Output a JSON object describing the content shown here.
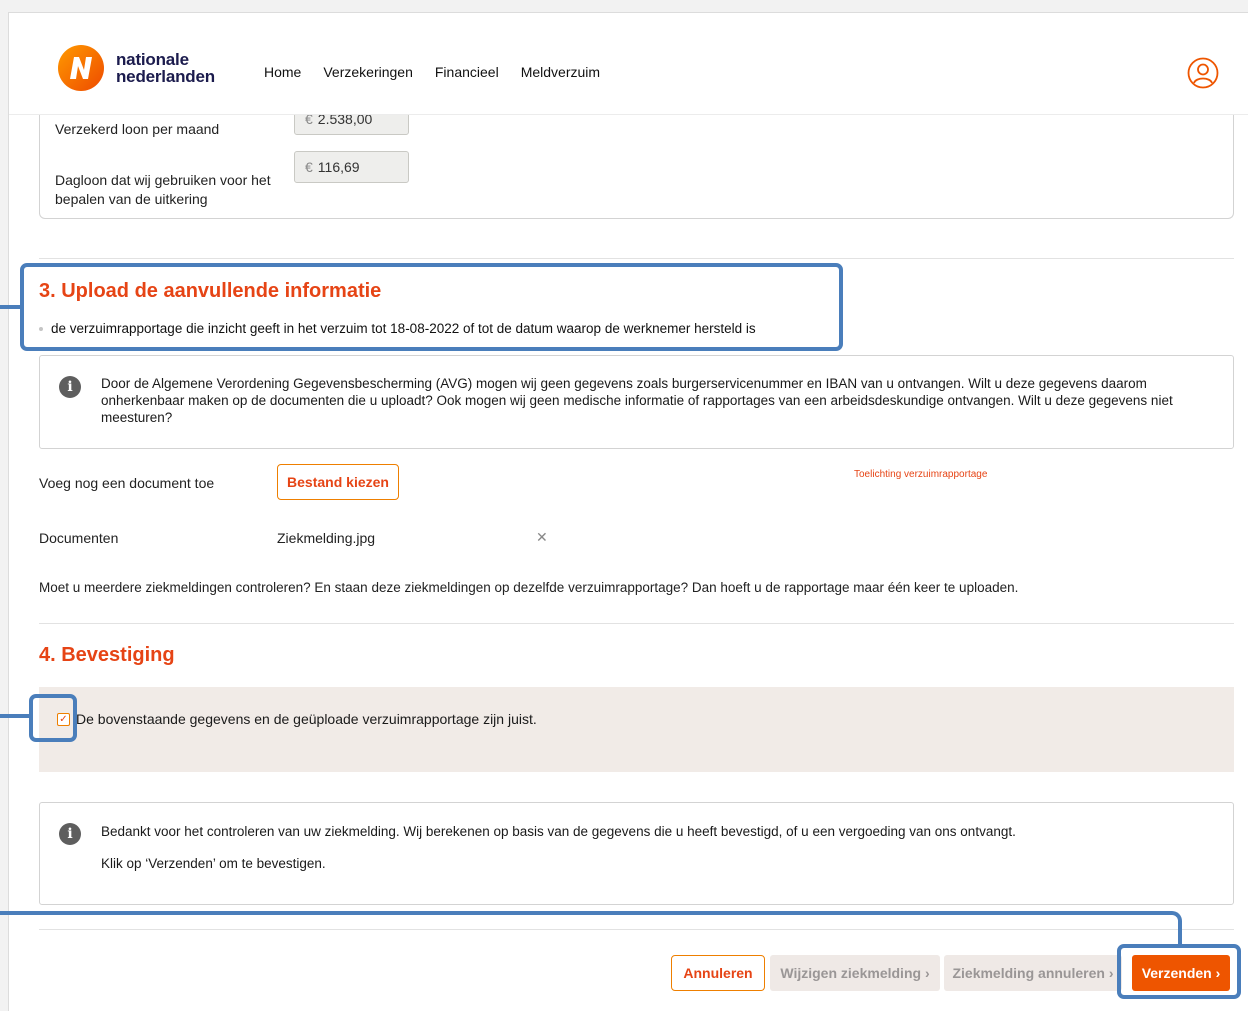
{
  "header": {
    "logo_line1": "nationale",
    "logo_line2": "nederlanden",
    "nav": [
      "Home",
      "Verzekeringen",
      "Financieel",
      "Meldverzuim"
    ]
  },
  "salary": {
    "insured_label": "Verzekerd loon per maand",
    "insured_currency": "€",
    "insured_value": "2.538,00",
    "daily_label": "Dagloon dat wij gebruiken voor het bepalen van de uitkering",
    "daily_currency": "€",
    "daily_value": "116,69"
  },
  "upload": {
    "title": "3. Upload de aanvullende informatie",
    "bullet": "de verzuimrapportage die inzicht geeft in het verzuim tot 18-08-2022 of tot de datum waarop de werknemer hersteld is",
    "info": "Door de Algemene Verordening Gegevensbescherming (AVG) mogen wij geen gegevens zoals burgerservicenummer en IBAN van u ontvangen. Wilt u deze gegevens daarom onherkenbaar maken op de documenten die u uploadt? Ook mogen wij geen medische informatie of rapportages van een arbeidsdeskundige ontvangen. Wilt u deze gegevens niet meesturen?",
    "add_doc_label": "Voeg nog een document toe",
    "choose_file": "Bestand kiezen",
    "explanation_link": "Toelichting verzuimrapportage",
    "documents_label": "Documenten",
    "document_name": "Ziekmelding.jpg",
    "remove_icon": "✕",
    "note": "Moet u meerdere ziekmeldingen controleren? En staan deze ziekmeldingen op dezelfde verzuimrapportage? Dan hoeft u de rapportage maar één keer te uploaden."
  },
  "confirmation": {
    "title": "4. Bevestiging",
    "checkbox_checked": true,
    "checkbox_label": "De bovenstaande gegevens en de geüploade verzuimrapportage zijn juist.",
    "info_line1": "Bedankt voor het controleren van uw ziekmelding. Wij berekenen op basis van de gegevens die u heeft bevestigd, of u een vergoeding van ons ontvangt.",
    "info_line2": "Klik op ‘Verzenden’ om te bevestigen."
  },
  "actions": {
    "cancel": "Annuleren",
    "edit": "Wijzigen ziekmelding",
    "cancel_report": "Ziekmelding annuleren",
    "send": "Verzenden"
  },
  "colors": {
    "brand_orange": "#ee5500",
    "heading_orange": "#e64415",
    "highlight_blue": "#4a7ebb"
  }
}
